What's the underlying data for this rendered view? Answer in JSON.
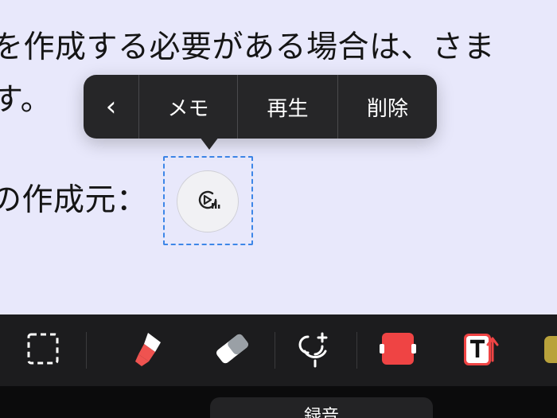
{
  "note": {
    "line1": "を作成する必要がある場合は、さま",
    "line2": "す。",
    "line3": "の作成元："
  },
  "context_menu": {
    "back_label": "‹",
    "memo_label": "メモ",
    "play_label": "再生",
    "delete_label": "削除"
  },
  "toolbar": {
    "tools": [
      {
        "name": "lasso-select",
        "icon": "dashed-square-icon"
      },
      {
        "name": "highlighter",
        "icon": "highlighter-icon",
        "color": "#ef5350"
      },
      {
        "name": "eraser",
        "icon": "eraser-icon"
      },
      {
        "name": "audio-record",
        "icon": "microphone-plus-icon"
      },
      {
        "name": "shape-frame",
        "icon": "red-frame-icon",
        "color": "#ef4444"
      },
      {
        "name": "text-tool",
        "icon": "text-box-icon",
        "color": "#ef4444"
      },
      {
        "name": "sticky-tool",
        "icon": "sticky-note-icon",
        "color": "#b9a23b"
      }
    ]
  },
  "bottom_bar": {
    "tab_label": "録音"
  },
  "colors": {
    "canvas": "#e8e8fb",
    "menu": "#262628",
    "selection": "#3d86e8",
    "toolbar": "#1c1c1e"
  }
}
